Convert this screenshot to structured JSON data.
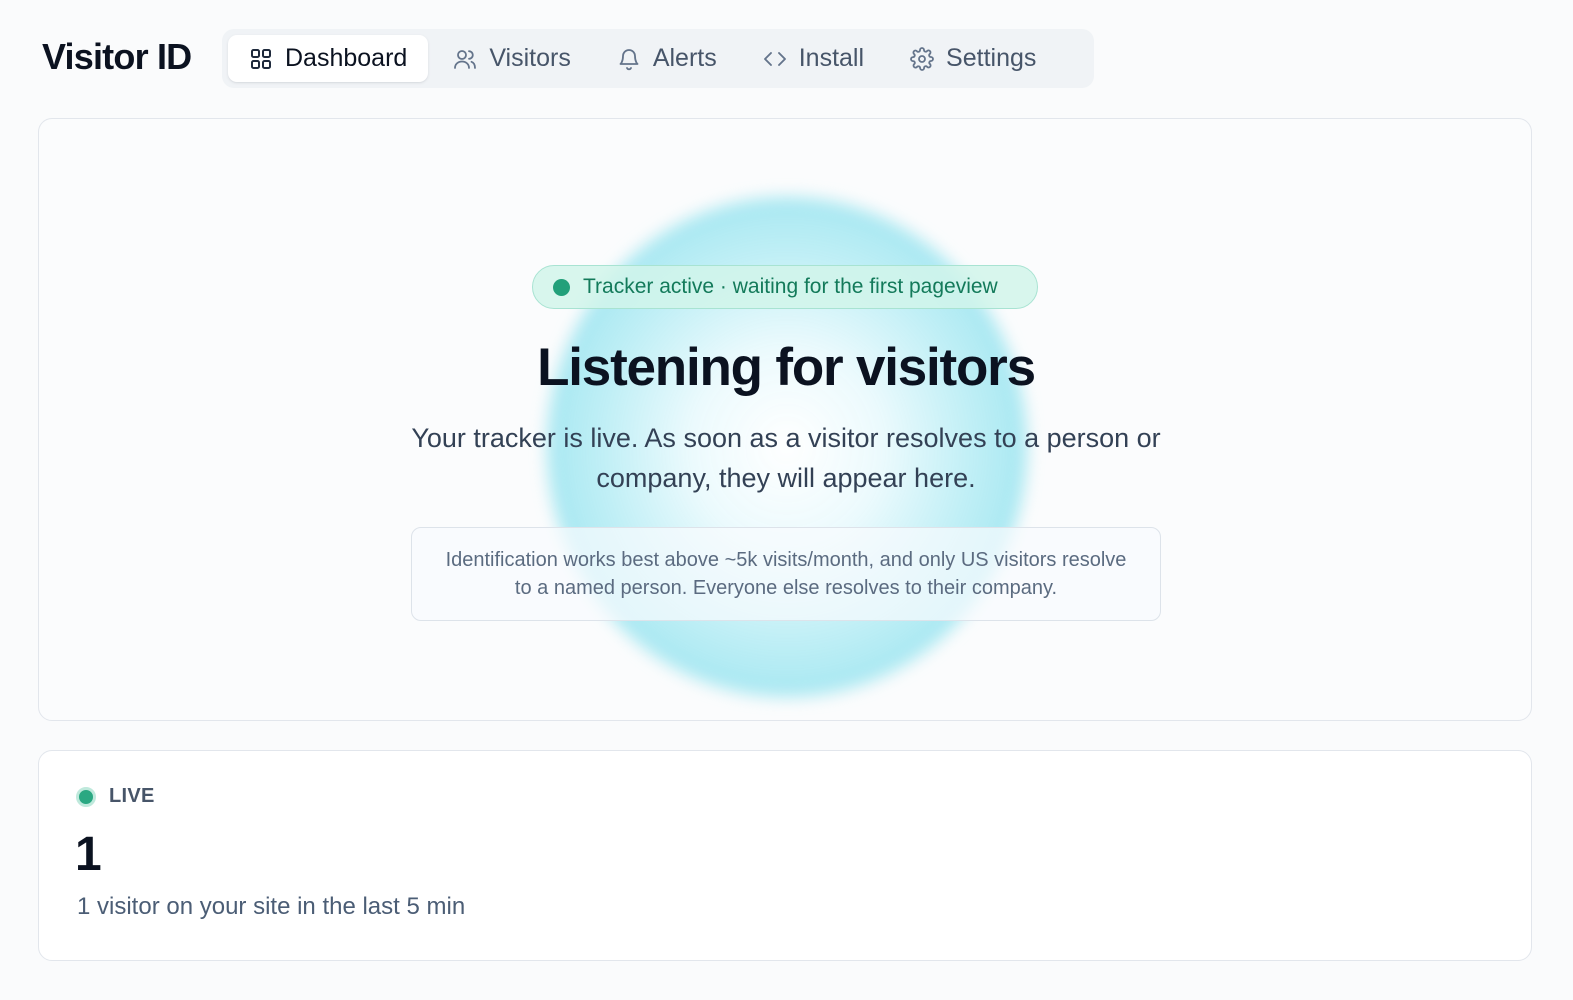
{
  "app": {
    "brand": "Visitor ID"
  },
  "nav": {
    "items": [
      {
        "label": "Dashboard",
        "icon": "grid-icon",
        "active": true
      },
      {
        "label": "Visitors",
        "icon": "users-icon",
        "active": false
      },
      {
        "label": "Alerts",
        "icon": "bell-icon",
        "active": false
      },
      {
        "label": "Install",
        "icon": "code-icon",
        "active": false
      },
      {
        "label": "Settings",
        "icon": "gear-icon",
        "active": false
      }
    ]
  },
  "hero": {
    "status": "Tracker active · waiting for the first pageview",
    "title": "Listening for visitors",
    "subtitle": "Your tracker is live. As soon as a visitor resolves to a person or company, they will appear here.",
    "note": "Identification works best above ~5k visits/month, and only US visitors resolve to a named person. Everyone else resolves to their company."
  },
  "live": {
    "label": "LIVE",
    "count": "1",
    "caption": "1 visitor on your site in the last 5 min"
  },
  "colors": {
    "accent_green": "#22a07a",
    "glow_cyan": "#91e2ee",
    "text_primary": "#0b1220",
    "text_secondary": "#475569"
  }
}
